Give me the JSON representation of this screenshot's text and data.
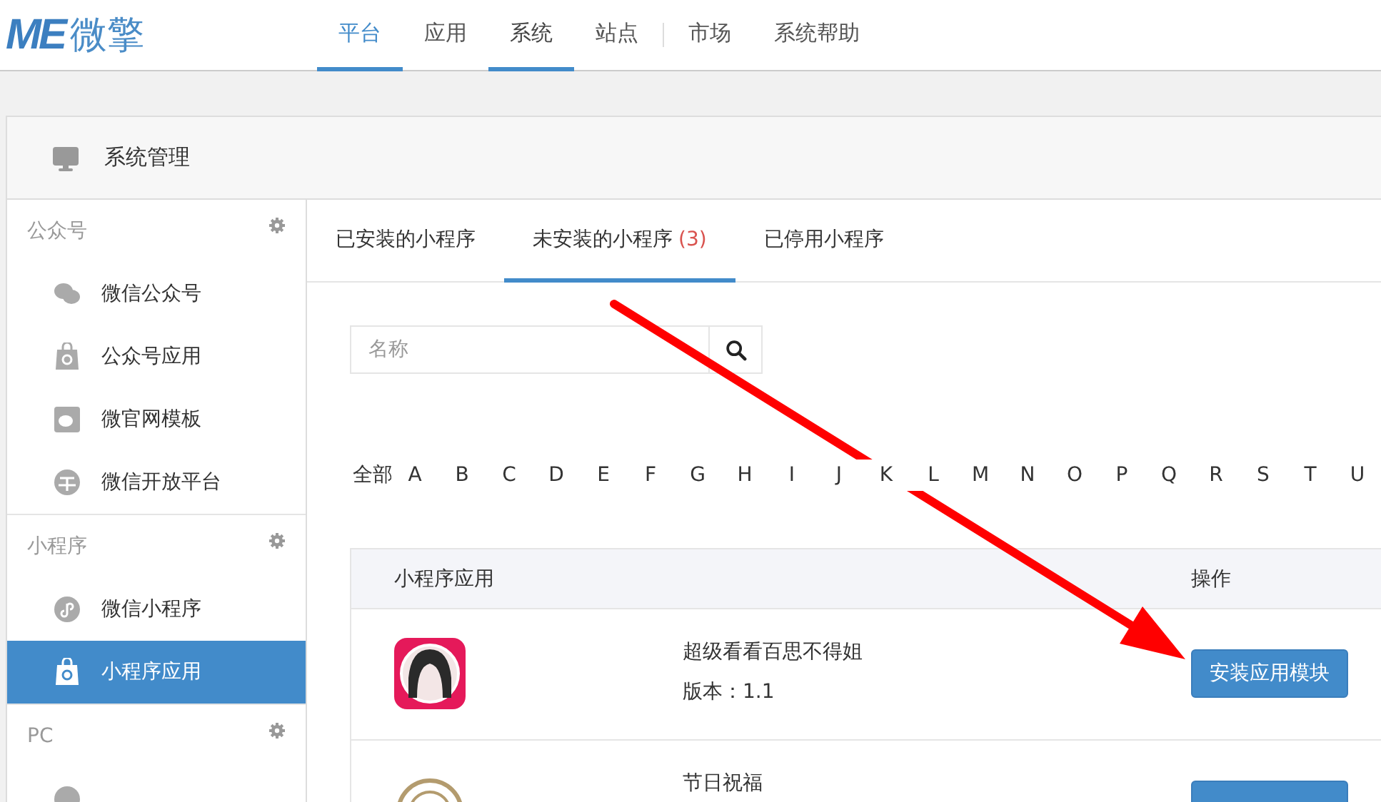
{
  "header": {
    "logo": {
      "mark": "ME",
      "name": "微擎"
    },
    "nav": [
      {
        "label": "平台",
        "selected": true,
        "hovered": true
      },
      {
        "label": "应用",
        "selected": false,
        "hovered": false
      },
      {
        "label": "系统",
        "selected": true,
        "hovered": false
      },
      {
        "label": "站点",
        "selected": false,
        "hovered": false
      }
    ],
    "nav_extra": [
      {
        "label": "市场"
      },
      {
        "label": "系统帮助"
      }
    ]
  },
  "panel": {
    "title": "系统管理"
  },
  "sidebar": {
    "groups": [
      {
        "title": "公众号",
        "items": [
          {
            "label": "微信公众号",
            "kind": "chat",
            "selected": false
          },
          {
            "label": "公众号应用",
            "kind": "bag",
            "selected": false
          },
          {
            "label": "微官网模板",
            "kind": "template",
            "selected": false
          },
          {
            "label": "微信开放平台",
            "kind": "platform",
            "selected": false
          }
        ]
      },
      {
        "title": "小程序",
        "items": [
          {
            "label": "微信小程序",
            "kind": "mini",
            "selected": false
          },
          {
            "label": "小程序应用",
            "kind": "bag",
            "selected": true
          }
        ]
      },
      {
        "title": "PC",
        "items": [
          {
            "kind": "circle",
            "selected": false
          }
        ]
      }
    ]
  },
  "tabs": [
    {
      "label": "已安装的小程序",
      "selected": false
    },
    {
      "label": "未安装的小程序",
      "count": "(3)",
      "selected": true
    },
    {
      "label": "已停用小程序",
      "selected": false
    }
  ],
  "search": {
    "placeholder": "名称"
  },
  "letters": [
    "全部",
    "A",
    "B",
    "C",
    "D",
    "E",
    "F",
    "G",
    "H",
    "I",
    "J",
    "K",
    "L",
    "M",
    "N",
    "O",
    "P",
    "Q",
    "R",
    "S",
    "T",
    "U"
  ],
  "table": {
    "columns": [
      "小程序应用",
      "操作"
    ],
    "rows": [
      {
        "kind": "avatar",
        "title": "超级看看百思不得姐",
        "version": "版本：1.1",
        "action": "安装应用模块"
      },
      {
        "kind": "seal",
        "title": "节日祝福"
      }
    ]
  },
  "annotation": {
    "kind": "arrow"
  }
}
